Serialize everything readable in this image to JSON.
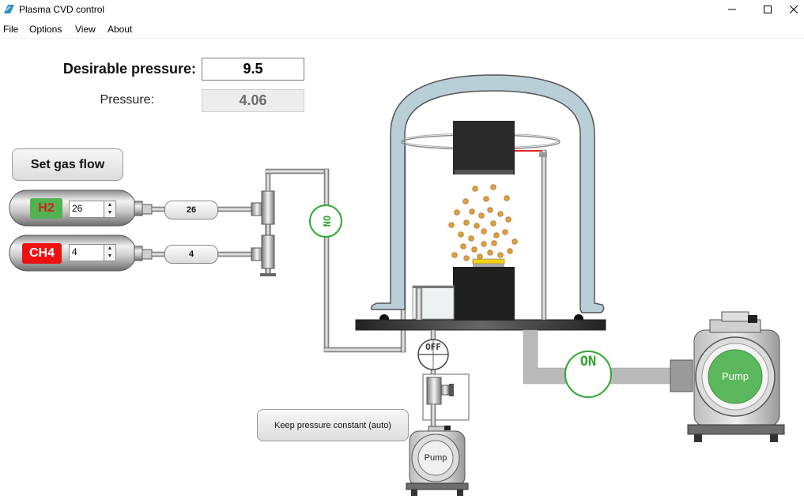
{
  "window": {
    "title": "Plasma CVD control"
  },
  "menu": [
    "File",
    "Options",
    "View",
    "About"
  ],
  "controls": {
    "desired_label": "Desirable pressure:",
    "desired_value": "9.5",
    "pressure_label": "Pressure:",
    "pressure_value": "4.06",
    "set_gas_button": "Set gas flow",
    "keep_pressure_button": "Keep pressure constant (auto)"
  },
  "gases": [
    {
      "name": "H2",
      "setpoint": "26",
      "flow": "26",
      "label_bg": "#52b252",
      "label_fg": "#d42020"
    },
    {
      "name": "CH4",
      "setpoint": "4",
      "flow": "4",
      "label_bg": "#ee1111",
      "label_fg": "#ffffff"
    }
  ],
  "valves": {
    "gas_line": "ON",
    "small_pump_line": "OFF",
    "main_pump_line": "ON"
  },
  "pumps": {
    "main": "Pump",
    "small": "Pump"
  },
  "colors": {
    "on": "#2ea82e",
    "off": "#333333",
    "pump_active": "#5cb85c",
    "chamber": "#b8cdd6",
    "particle": "#e0a040"
  }
}
